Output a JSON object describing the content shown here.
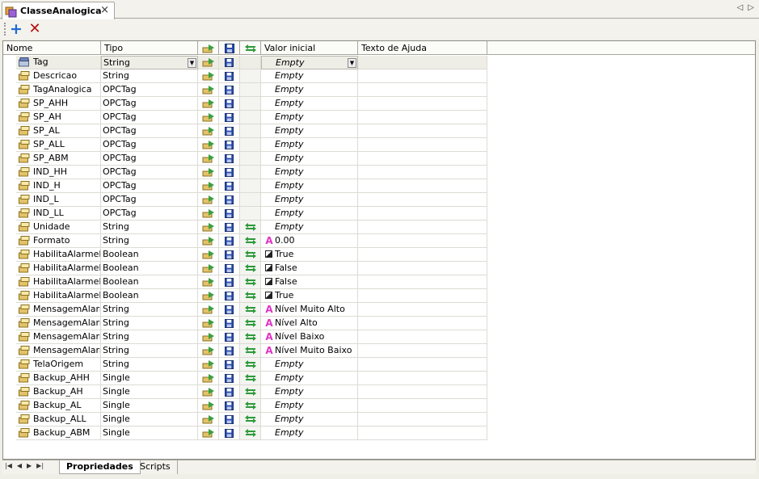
{
  "document_tab": {
    "title": "ClasseAnalogica",
    "close": "×"
  },
  "toolbar": {
    "add": "+",
    "delete": "✕"
  },
  "columns": {
    "name": "Nome",
    "type": "Tipo",
    "initial": "Valor inicial",
    "help": "Texto de Ajuda"
  },
  "rows": [
    {
      "name": "Tag",
      "type": "String",
      "value": "Empty",
      "kind": "empty",
      "retentive": false
    },
    {
      "name": "Descricao",
      "type": "String",
      "value": "Empty",
      "kind": "empty",
      "retentive": false
    },
    {
      "name": "TagAnalogica",
      "type": "OPCTag",
      "value": "Empty",
      "kind": "empty",
      "retentive": false
    },
    {
      "name": "SP_AHH",
      "type": "OPCTag",
      "value": "Empty",
      "kind": "empty",
      "retentive": false
    },
    {
      "name": "SP_AH",
      "type": "OPCTag",
      "value": "Empty",
      "kind": "empty",
      "retentive": false
    },
    {
      "name": "SP_AL",
      "type": "OPCTag",
      "value": "Empty",
      "kind": "empty",
      "retentive": false
    },
    {
      "name": "SP_ALL",
      "type": "OPCTag",
      "value": "Empty",
      "kind": "empty",
      "retentive": false
    },
    {
      "name": "SP_ABM",
      "type": "OPCTag",
      "value": "Empty",
      "kind": "empty",
      "retentive": false
    },
    {
      "name": "IND_HH",
      "type": "OPCTag",
      "value": "Empty",
      "kind": "empty",
      "retentive": false
    },
    {
      "name": "IND_H",
      "type": "OPCTag",
      "value": "Empty",
      "kind": "empty",
      "retentive": false
    },
    {
      "name": "IND_L",
      "type": "OPCTag",
      "value": "Empty",
      "kind": "empty",
      "retentive": false
    },
    {
      "name": "IND_LL",
      "type": "OPCTag",
      "value": "Empty",
      "kind": "empty",
      "retentive": false
    },
    {
      "name": "Unidade",
      "type": "String",
      "value": "Empty",
      "kind": "empty",
      "retentive": true
    },
    {
      "name": "Formato",
      "type": "String",
      "value": "0.00",
      "kind": "string",
      "retentive": true
    },
    {
      "name": "HabilitaAlarmeHH",
      "type": "Boolean",
      "value": "True",
      "kind": "bool",
      "retentive": true
    },
    {
      "name": "HabilitaAlarmeH",
      "type": "Boolean",
      "value": "False",
      "kind": "bool",
      "retentive": true
    },
    {
      "name": "HabilitaAlarmeL",
      "type": "Boolean",
      "value": "False",
      "kind": "bool",
      "retentive": true
    },
    {
      "name": "HabilitaAlarmeLL",
      "type": "Boolean",
      "value": "True",
      "kind": "bool",
      "retentive": true
    },
    {
      "name": "MensagemAlarmeHH",
      "type": "String",
      "value": "Nível Muito Alto",
      "kind": "string",
      "retentive": true
    },
    {
      "name": "MensagemAlarmeH",
      "type": "String",
      "value": "Nível Alto",
      "kind": "string",
      "retentive": true
    },
    {
      "name": "MensagemAlarmeL",
      "type": "String",
      "value": "Nível Baixo",
      "kind": "string",
      "retentive": true
    },
    {
      "name": "MensagemAlarmeLL",
      "type": "String",
      "value": "Nível Muito Baixo",
      "kind": "string",
      "retentive": true
    },
    {
      "name": "TelaOrigem",
      "type": "String",
      "value": "Empty",
      "kind": "empty",
      "retentive": true
    },
    {
      "name": "Backup_AHH",
      "type": "Single",
      "value": "Empty",
      "kind": "empty",
      "retentive": true
    },
    {
      "name": "Backup_AH",
      "type": "Single",
      "value": "Empty",
      "kind": "empty",
      "retentive": true
    },
    {
      "name": "Backup_AL",
      "type": "Single",
      "value": "Empty",
      "kind": "empty",
      "retentive": true
    },
    {
      "name": "Backup_ALL",
      "type": "Single",
      "value": "Empty",
      "kind": "empty",
      "retentive": true
    },
    {
      "name": "Backup_ABM",
      "type": "Single",
      "value": "Empty",
      "kind": "empty",
      "retentive": true
    }
  ],
  "bottom_tabs": {
    "active": "Propriedades",
    "inactive": "Scripts"
  },
  "colors": {
    "value_string_icon": "#e033c6",
    "add_icon": "#1b6ad6",
    "delete_icon": "#b41212",
    "retentive_arrows": "#2d9a3a"
  }
}
